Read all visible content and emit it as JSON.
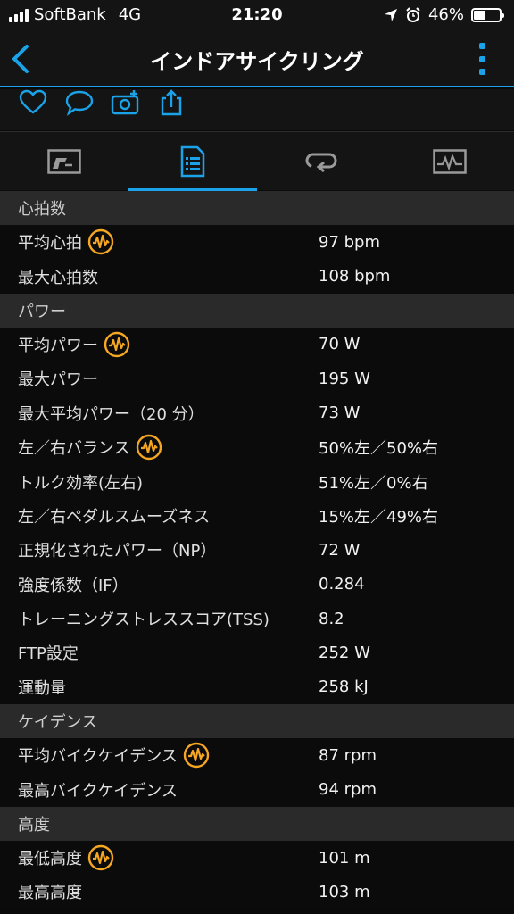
{
  "status": {
    "carrier": "SoftBank",
    "network": "4G",
    "time": "21:20",
    "battery": "46%",
    "battery_level": 0.46
  },
  "header": {
    "title": "インドアサイクリング"
  },
  "colors": {
    "accent": "#1aa3e8",
    "badge": "#f5a623",
    "section_bg": "#2a2a2a"
  },
  "actions": [
    "heart-icon",
    "comment-icon",
    "add-photo-icon",
    "share-icon"
  ],
  "tabs": [
    {
      "icon": "overview-icon",
      "active": false
    },
    {
      "icon": "stats-list-icon",
      "active": true
    },
    {
      "icon": "laps-icon",
      "active": false
    },
    {
      "icon": "charts-icon",
      "active": false
    }
  ],
  "sections": [
    {
      "title": "心拍数",
      "rows": [
        {
          "label": "平均心拍",
          "value": "97 bpm",
          "badge": true
        },
        {
          "label": "最大心拍数",
          "value": "108 bpm",
          "badge": false
        }
      ]
    },
    {
      "title": "パワー",
      "rows": [
        {
          "label": "平均パワー",
          "value": "70 W",
          "badge": true
        },
        {
          "label": "最大パワー",
          "value": "195 W",
          "badge": false
        },
        {
          "label": "最大平均パワー（20 分）",
          "value": "73 W",
          "badge": false
        },
        {
          "label": "左／右バランス",
          "value": "50%左／50%右",
          "badge": true
        },
        {
          "label": "トルク効率(左右)",
          "value": "51%左／0%右",
          "badge": false
        },
        {
          "label": "左／右ペダルスムーズネス",
          "value": "15%左／49%右",
          "badge": false
        },
        {
          "label": "正規化されたパワー（NP）",
          "value": "72 W",
          "badge": false
        },
        {
          "label": "強度係数（IF）",
          "value": "0.284",
          "badge": false
        },
        {
          "label": "トレーニングストレススコア(TSS)",
          "value": "8.2",
          "badge": false
        },
        {
          "label": "FTP設定",
          "value": "252 W",
          "badge": false
        },
        {
          "label": "運動量",
          "value": "258 kJ",
          "badge": false
        }
      ]
    },
    {
      "title": "ケイデンス",
      "rows": [
        {
          "label": "平均バイクケイデンス",
          "value": "87 rpm",
          "badge": true
        },
        {
          "label": "最高バイクケイデンス",
          "value": "94 rpm",
          "badge": false
        }
      ]
    },
    {
      "title": "高度",
      "rows": [
        {
          "label": "最低高度",
          "value": "101 m",
          "badge": true
        },
        {
          "label": "最高高度",
          "value": "103 m",
          "badge": false
        }
      ]
    }
  ]
}
